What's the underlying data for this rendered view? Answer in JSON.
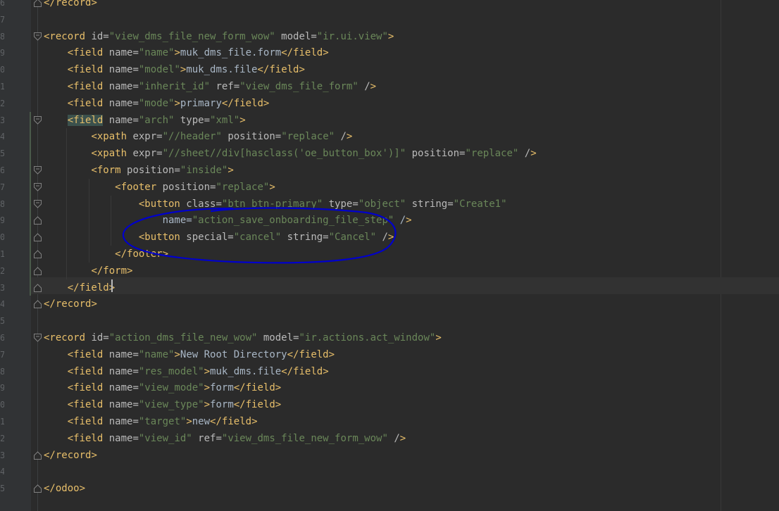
{
  "editor": {
    "line_numbers": [
      "6",
      "7",
      "8",
      "9",
      "0",
      "1",
      "2",
      "3",
      "4",
      "5",
      "6",
      "7",
      "8",
      "9",
      "0",
      "1",
      "2",
      "3",
      "4",
      "5",
      "6",
      "7",
      "8",
      "9",
      "0",
      "1",
      "2",
      "3",
      "4",
      "5"
    ],
    "line_numbers_bottom": [
      "6",
      "7",
      "8",
      "9",
      "0",
      "1",
      "2",
      "3",
      "4",
      "5"
    ],
    "code_lines": [
      "</record>",
      "",
      "<record id=\"view_dms_file_new_form_wow\" model=\"ir.ui.view\">",
      "    <field name=\"name\">muk_dms_file.form</field>",
      "    <field name=\"model\">muk_dms.file</field>",
      "    <field name=\"inherit_id\" ref=\"view_dms_file_form\" />",
      "    <field name=\"mode\">primary</field>",
      "    <field name=\"arch\" type=\"xml\">",
      "        <xpath expr=\"//header\" position=\"replace\" />",
      "        <xpath expr=\"//sheet//div[hasclass('oe_button_box')]\" position=\"replace\" />",
      "        <form position=\"inside\">",
      "            <footer position=\"replace\">",
      "                <button class=\"btn btn-primary\" type=\"object\" string=\"Create1\"",
      "                    name=\"action_save_onboarding_file_step\" />",
      "                <button special=\"cancel\" string=\"Cancel\" />",
      "            </footer>",
      "        </form>",
      "    </field>",
      "</record>",
      "",
      "<record id=\"action_dms_file_new_wow\" model=\"ir.actions.act_window\">",
      "    <field name=\"name\">New Root Directory</field>",
      "    <field name=\"res_model\">muk_dms.file</field>",
      "    <field name=\"view_mode\">form</field>",
      "    <field name=\"view_type\">form</field>",
      "    <field name=\"target\">new</field>",
      "    <field name=\"view_id\" ref=\"view_dms_file_new_form_wow\" />",
      "</record>",
      "",
      "</odoo>"
    ],
    "colors": {
      "background": "#2b2b2b",
      "gutter": "#313335",
      "tag": "#e8bf6a",
      "attribute": "#bababa",
      "string": "#6a8759",
      "text": "#a9b7c6",
      "annotation": "#0000cc"
    },
    "icons": [
      "fold-open-icon",
      "fold-close-icon"
    ]
  }
}
